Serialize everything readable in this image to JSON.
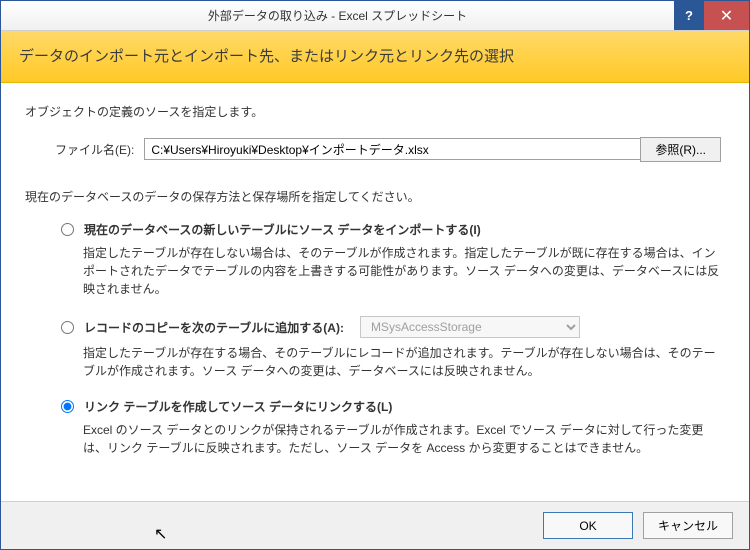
{
  "titlebar": {
    "title": "外部データの取り込み - Excel スプレッドシート"
  },
  "header": {
    "heading": "データのインポート元とインポート先、またはリンク元とリンク先の選択"
  },
  "instruction": "オブジェクトの定義のソースを指定します。",
  "file": {
    "label": "ファイル名(E):",
    "value": "C:¥Users¥Hiroyuki¥Desktop¥インポートデータ.xlsx",
    "browse": "参照(R)..."
  },
  "subinstruction": "現在のデータベースのデータの保存方法と保存場所を指定してください。",
  "options": [
    {
      "title": "現在のデータベースの新しいテーブルにソース データをインポートする(I)",
      "desc": "指定したテーブルが存在しない場合は、そのテーブルが作成されます。指定したテーブルが既に存在する場合は、インポートされたデータでテーブルの内容を上書きする可能性があります。ソース データへの変更は、データベースには反映されません。",
      "checked": false
    },
    {
      "title": "レコードのコピーを次のテーブルに追加する(A):",
      "desc": "指定したテーブルが存在する場合、そのテーブルにレコードが追加されます。テーブルが存在しない場合は、そのテーブルが作成されます。ソース データへの変更は、データベースには反映されません。",
      "checked": false,
      "combo": "MSysAccessStorage"
    },
    {
      "title": "リンク テーブルを作成してソース データにリンクする(L)",
      "desc": "Excel のソース データとのリンクが保持されるテーブルが作成されます。Excel でソース データに対して行った変更は、リンク テーブルに反映されます。ただし、ソース データを Access から変更することはできません。",
      "checked": true
    }
  ],
  "footer": {
    "ok": "OK",
    "cancel": "キャンセル"
  }
}
